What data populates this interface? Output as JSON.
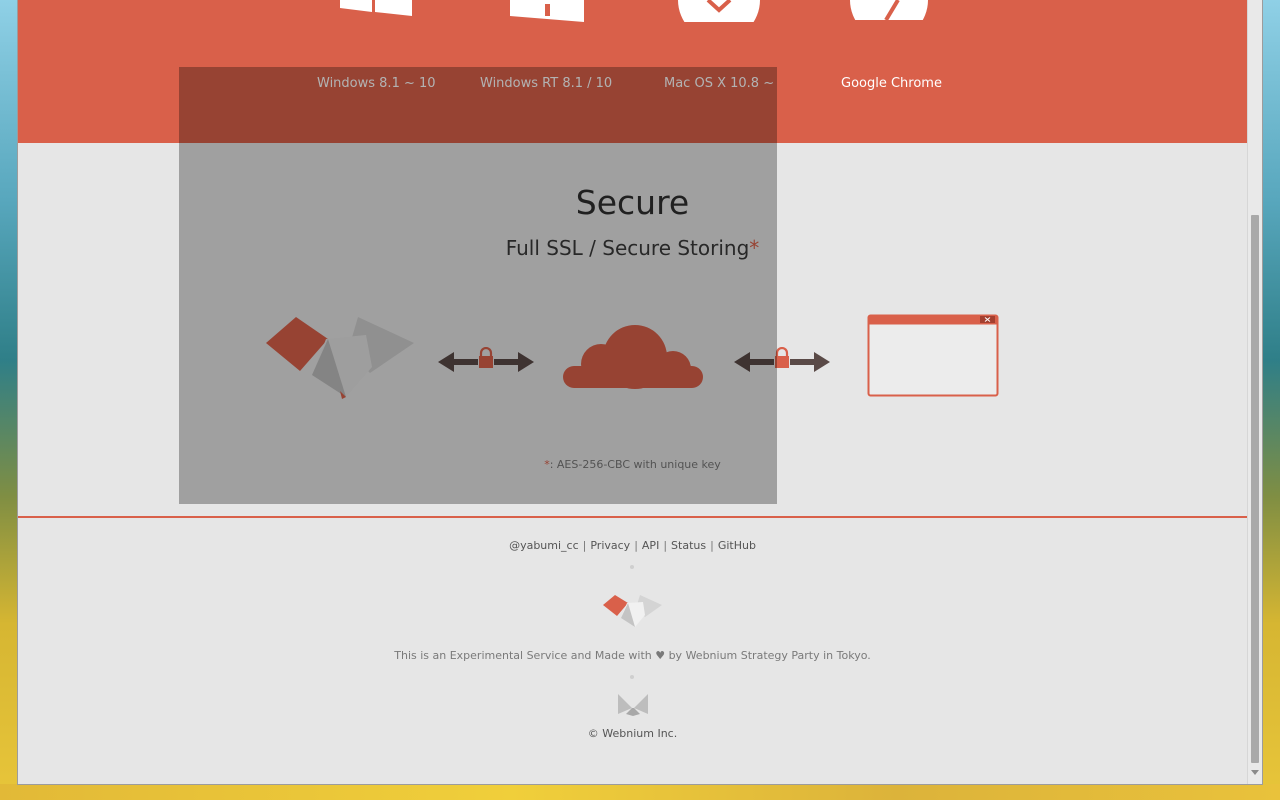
{
  "platforms": [
    {
      "label": "Windows 8.1 ~ 10",
      "icon": "windows-icon"
    },
    {
      "label": "Windows RT 8.1 / 10",
      "icon": "windows-store-icon"
    },
    {
      "label": "Mac OS X 10.8 ~",
      "icon": "mac-os-x-icon"
    },
    {
      "label": "Google Chrome",
      "icon": "chrome-icon"
    }
  ],
  "secure": {
    "title": "Secure",
    "subtitle": "Full SSL / Secure Storing",
    "asterisk": "*",
    "footnote_mark": "*",
    "footnote": ": AES-256-CBC with unique key"
  },
  "diagram": {
    "client_icon": "yabumi-logo-icon",
    "lock_icon": "lock-icon",
    "arrow_icon": "double-arrow-icon",
    "cloud_icon": "cloud-icon",
    "browser_icon": "browser-window-icon"
  },
  "footer": {
    "links": [
      "@yabumi_cc",
      "Privacy",
      "API",
      "Status",
      "GitHub"
    ],
    "separator": "|",
    "tagline": "This is an Experimental Service and Made with ♥ by Webnium Strategy Party in Tokyo.",
    "copyright": "© Webnium Inc."
  },
  "colors": {
    "accent": "#d9604a",
    "background": "#e6e6e6",
    "overlay": "rgba(0,0,0,0.30)"
  }
}
